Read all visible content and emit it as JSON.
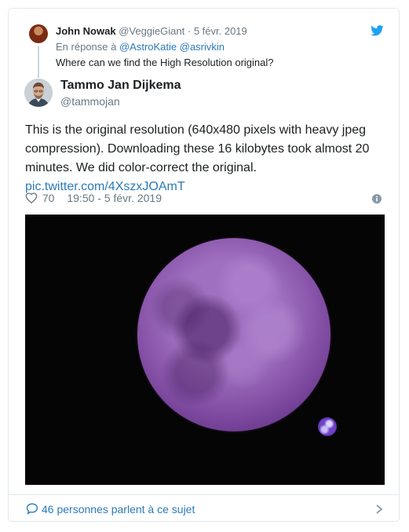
{
  "parent": {
    "name": "John Nowak",
    "handle": "@VeggieGiant",
    "dot": "·",
    "date": "5 févr. 2019",
    "reply_prefix": "En réponse à",
    "reply_to": "@AstroKatie @asrivkin",
    "text": "Where can we find the High Resolution original?"
  },
  "tweet": {
    "author_name": "Tammo Jan Dijkema",
    "author_handle": "@tammojan",
    "text_lines": [
      "This is the original resolution (640x480 pixels with heavy jpeg",
      "compression). Downloading these 16 kilobytes took almost 20",
      "minutes. We did color-correct the original."
    ],
    "link": "pic.twitter.com/4XszxJOAmT",
    "likes": "70",
    "timestamp": "19:50 - 5 févr. 2019"
  },
  "footer": {
    "conversation": "46 personnes parlent à ce sujet"
  },
  "colors": {
    "link": "#2b7bb9",
    "secondary_text": "#697882",
    "twitter_blue": "#1da1f2"
  },
  "icons": {
    "brand": "twitter-bird-icon",
    "like": "heart-icon",
    "info": "info-icon",
    "conversation": "speech-bubble-icon",
    "next": "chevron-right-icon"
  }
}
